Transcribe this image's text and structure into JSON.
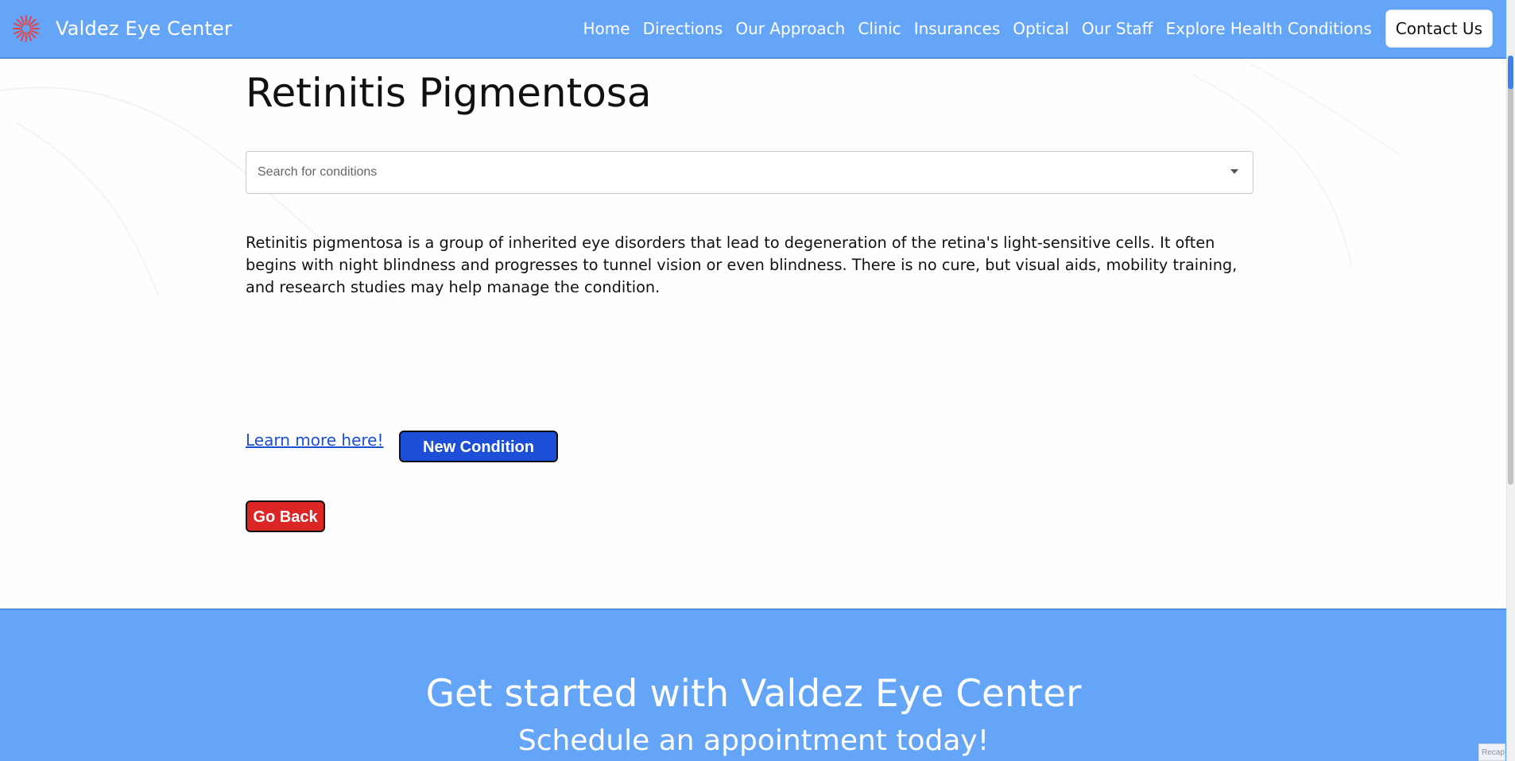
{
  "nav": {
    "brand": "Valdez Eye Center",
    "links": [
      {
        "label": "Home"
      },
      {
        "label": "Directions"
      },
      {
        "label": "Our Approach"
      },
      {
        "label": "Clinic"
      },
      {
        "label": "Insurances"
      },
      {
        "label": "Optical"
      },
      {
        "label": "Our Staff"
      },
      {
        "label": "Explore Health Conditions"
      }
    ],
    "contact_label": "Contact Us"
  },
  "main": {
    "title": "Retinitis Pigmentosa",
    "search": {
      "placeholder": "Search for conditions",
      "value": ""
    },
    "description": "Retinitis pigmentosa is a group of inherited eye disorders that lead to degeneration of the retina's light-sensitive cells. It often begins with night blindness and progresses to tunnel vision or even blindness. There is no cure, but visual aids, mobility training, and research studies may help manage the condition.",
    "learn_more_label": "Learn more here!",
    "new_condition_label": "New Condition",
    "go_back_label": "Go Back"
  },
  "footer": {
    "title": "Get started with Valdez Eye Center",
    "subtitle": "Schedule an appointment today!",
    "badge_text": "Recap"
  },
  "colors": {
    "nav_bg": "#64a5f8",
    "new_condition_bg": "#1d4ed8",
    "go_back_bg": "#dc2626",
    "link": "#1b4fd1",
    "logo": "#e0474c"
  },
  "icons": {
    "logo": "eye-iris-logo-icon",
    "dropdown": "caret-down-icon"
  }
}
